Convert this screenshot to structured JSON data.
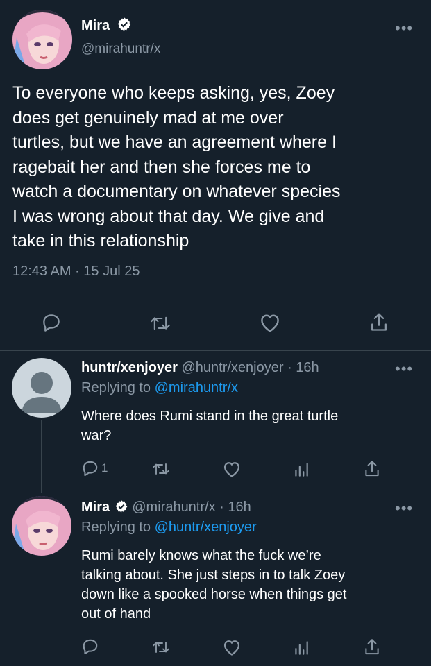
{
  "main_tweet": {
    "author_name": "Mira",
    "handle": "@mirahuntr/x",
    "text_lines": [
      "To everyone who keeps asking, yes, Zoey",
      "does get genuinely mad at me over",
      "turtles, but we have an agreement where I",
      "ragebait her and then she forces me to",
      "watch a documentary on whatever species",
      "I was wrong about that day. We give and",
      "take in this relationship"
    ],
    "timestamp": "12:43 AM · 15 Jul 25"
  },
  "reply1": {
    "author_name": "huntr/xenjoyer",
    "handle": "@huntr/xenjoyer",
    "time": "· 16h",
    "replying_prefix": "Replying to ",
    "replying_to": "@mirahuntr/x",
    "text_lines": [
      "Where does Rumi stand in the great turtle",
      "war?"
    ],
    "reply_count": "1"
  },
  "reply2": {
    "author_name": "Mira",
    "handle": "@mirahuntr/x",
    "time": "· 16h",
    "replying_prefix": "Replying to ",
    "replying_to": "@huntr/xenjoyer",
    "text_lines": [
      "Rumi barely knows what the fuck we’re",
      "talking about. She just steps in to talk Zoey",
      "down like a spooked horse when things get",
      "out of hand"
    ]
  },
  "colors": {
    "background": "#15202b",
    "secondary_text": "#8b98a5",
    "link": "#1d9bf0",
    "divider": "#38444d",
    "verified_badge": "#ffffff"
  },
  "icons": [
    "more-icon",
    "verified-icon",
    "reply-icon",
    "retweet-icon",
    "like-icon",
    "share-icon",
    "analytics-icon"
  ]
}
